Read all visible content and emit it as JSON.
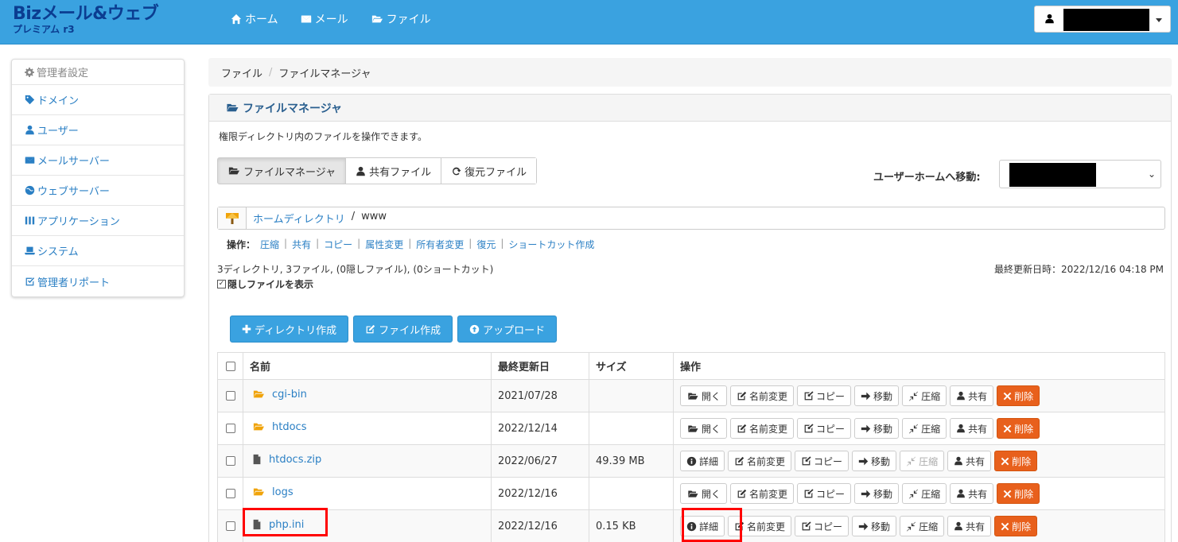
{
  "app": {
    "logo_main": "Bizメール&ウェブ",
    "logo_sub": "プレミアム r3",
    "nav": [
      {
        "label": "ホーム",
        "icon": "home-icon"
      },
      {
        "label": "メール",
        "icon": "mail-icon"
      },
      {
        "label": "ファイル",
        "icon": "folder-icon"
      }
    ]
  },
  "sidebar": {
    "header": "管理者設定",
    "items": [
      {
        "label": "ドメイン",
        "icon": "tag-icon"
      },
      {
        "label": "ユーザー",
        "icon": "user-icon"
      },
      {
        "label": "メールサーバー",
        "icon": "mail-icon"
      },
      {
        "label": "ウェブサーバー",
        "icon": "globe-icon"
      },
      {
        "label": "アプリケーション",
        "icon": "columns-icon"
      },
      {
        "label": "システム",
        "icon": "laptop-icon"
      },
      {
        "label": "管理者リポート",
        "icon": "check-square-icon"
      }
    ]
  },
  "breadcrumb": [
    "ファイル",
    "ファイルマネージャ"
  ],
  "panel": {
    "title": "ファイルマネージャ",
    "description": "権限ディレクトリ内のファイルを操作できます。",
    "tabs": [
      {
        "label": "ファイルマネージャ",
        "icon": "folder-open-icon",
        "active": true
      },
      {
        "label": "共有ファイル",
        "icon": "user-icon",
        "active": false
      },
      {
        "label": "復元ファイル",
        "icon": "refresh-icon",
        "active": false
      }
    ],
    "jump_label": "ユーザーホームへ移動:",
    "path": {
      "home": "ホームディレクトリ",
      "sep": "/",
      "current": "www"
    },
    "operations_label": "操作：",
    "operations": [
      "圧縮",
      "共有",
      "コピー",
      "属性変更",
      "所有者変更",
      "復元",
      "ショートカット作成"
    ],
    "counts": "3ディレクトリ, 3ファイル, (0隠しファイル), (0ショートカット)",
    "last_updated": "最終更新日時：2022/12/16 04:18 PM",
    "show_hidden": "隠しファイルを表示",
    "buttons": {
      "mkdir": "ディレクトリ作成",
      "mkfile": "ファイル作成",
      "upload": "アップロード"
    }
  },
  "table": {
    "headers": {
      "name": "名前",
      "modified": "最終更新日",
      "size": "サイズ",
      "ops": "操作"
    },
    "op_labels": {
      "open": "開く",
      "detail": "詳細",
      "rename": "名前変更",
      "copy": "コピー",
      "move": "移動",
      "compress": "圧縮",
      "share": "共有",
      "delete": "削除"
    },
    "rows": [
      {
        "name": "cgi-bin",
        "type": "folder",
        "modified": "2021/07/28",
        "size": ""
      },
      {
        "name": "htdocs",
        "type": "folder",
        "modified": "2022/12/14",
        "size": ""
      },
      {
        "name": "htdocs.zip",
        "type": "file",
        "modified": "2022/06/27",
        "size": "49.39 MB"
      },
      {
        "name": "logs",
        "type": "folder",
        "modified": "2022/12/16",
        "size": ""
      },
      {
        "name": "php.ini",
        "type": "file",
        "modified": "2022/12/16",
        "size": "0.15 KB"
      }
    ]
  },
  "colors": {
    "brand": "#3aa2e0",
    "link": "#2a7fc4",
    "danger": "#e8601c",
    "folder": "#f0a30a",
    "highlight": "#ff0000"
  }
}
